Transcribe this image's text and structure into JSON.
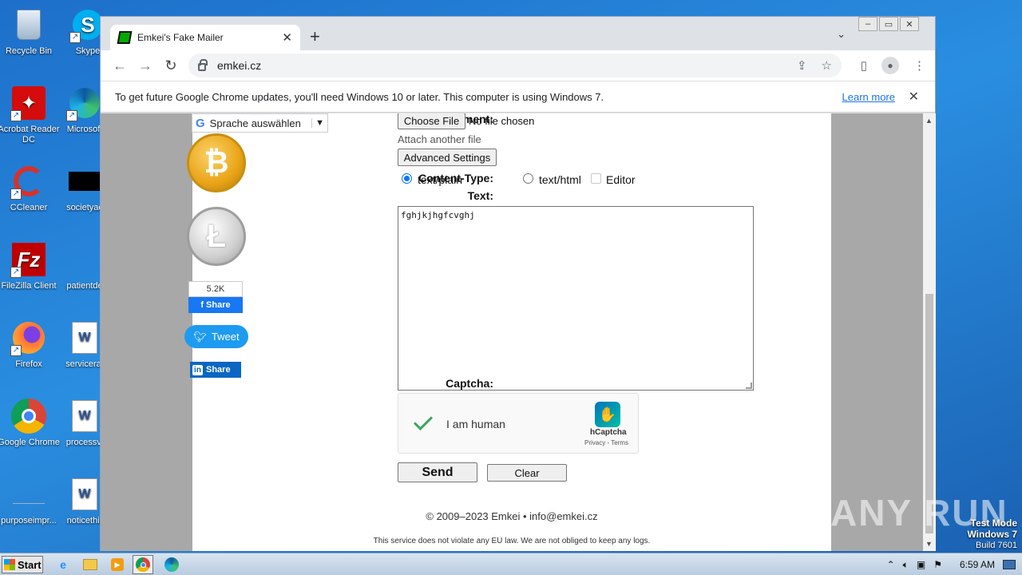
{
  "desktop": {
    "icons": [
      {
        "label": "Recycle Bin"
      },
      {
        "label": "Skype"
      },
      {
        "label": "Acrobat Reader DC"
      },
      {
        "label": "Microsoft"
      },
      {
        "label": "CCleaner"
      },
      {
        "label": "societyac"
      },
      {
        "label": "FileZilla Client"
      },
      {
        "label": "patientde"
      },
      {
        "label": "Firefox"
      },
      {
        "label": "servicerat"
      },
      {
        "label": "Google Chrome"
      },
      {
        "label": "processvi"
      },
      {
        "label": "purposeimpr..."
      },
      {
        "label": "noticethir"
      }
    ],
    "watermark": "ANY RUN",
    "test_mode": {
      "line1": "Test Mode",
      "line2": "Windows 7",
      "line3": "Build 7601"
    }
  },
  "browser": {
    "tab_title": "Emkei's Fake Mailer",
    "url": "emkei.cz",
    "infobar": {
      "message": "To get future Google Chrome updates, you'll need Windows 10 or later. This computer is using Windows 7.",
      "link": "Learn more"
    }
  },
  "page": {
    "language_selector": "Sprache auswählen",
    "social": {
      "fb_count": "5.2K",
      "fb_share": "Share",
      "tweet": "Tweet",
      "li_share": "Share"
    },
    "form": {
      "attachment_label": "Attachment:",
      "choose_file": "Choose File",
      "no_file": "No file chosen",
      "attach_another": "Attach another file",
      "advanced_settings": "Advanced Settings",
      "content_type_label": "Content-Type:",
      "content_types": [
        "text/plain",
        "text/html",
        "Editor"
      ],
      "content_type_selected": "text/plain",
      "text_label": "Text:",
      "text_value": "fghjkjhgfcvghj",
      "captcha_label": "Captcha:",
      "captcha_text": "I am human",
      "captcha_brand": "hCaptcha",
      "captcha_links": "Privacy - Terms",
      "send": "Send",
      "clear": "Clear"
    },
    "footer": {
      "copyright": "© 2009–2023 Emkei • info@emkei.cz",
      "notice": "This service does not violate any EU law. We are not obliged to keep any logs."
    }
  },
  "taskbar": {
    "start": "Start",
    "clock": "6:59 AM"
  }
}
